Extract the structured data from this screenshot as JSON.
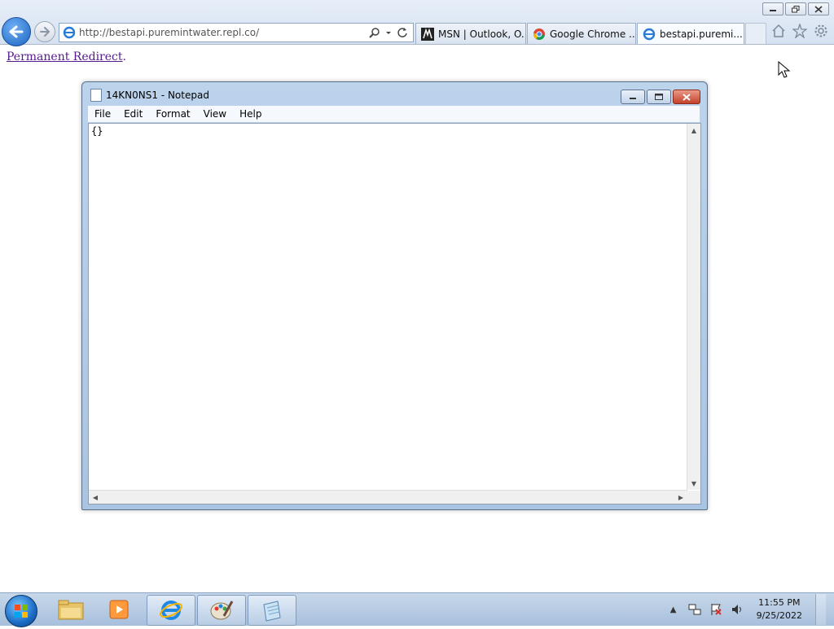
{
  "browser": {
    "url": "http://bestapi.puremintwater.repl.co/",
    "tabs": [
      {
        "label": "MSN | Outlook, O...",
        "icon": "msn-icon",
        "active": false
      },
      {
        "label": "Google Chrome ...",
        "icon": "chrome-icon",
        "active": false
      },
      {
        "label": "bestapi.puremi...",
        "icon": "ie-page-icon",
        "active": true,
        "close": "×"
      }
    ]
  },
  "page": {
    "link_text": "Permanent Redirect",
    "trailing_text": "."
  },
  "notepad": {
    "title": "14KN0NS1 - Notepad",
    "menu": [
      "File",
      "Edit",
      "Format",
      "View",
      "Help"
    ],
    "content": "{}"
  },
  "taskbar": {
    "pinned": [
      {
        "name": "file-explorer-icon",
        "open": false
      },
      {
        "name": "media-player-icon",
        "open": false
      },
      {
        "name": "internet-explorer-icon",
        "open": true
      },
      {
        "name": "paint-icon",
        "open": true
      },
      {
        "name": "notepad-icon",
        "open": true
      }
    ],
    "clock_time": "11:55 PM",
    "clock_date": "9/25/2022"
  },
  "colors": {
    "link": "#551a8b",
    "accent_blue": "#1c63c2",
    "close_red": "#c4412b"
  }
}
